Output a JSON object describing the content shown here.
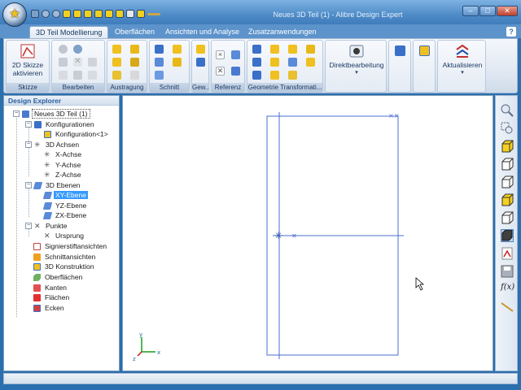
{
  "window": {
    "title": "Neues 3D Teil (1) - Alibre Design Expert",
    "minimize": "–",
    "maximize": "□",
    "close": "✕"
  },
  "ribbon": {
    "tabs": [
      {
        "label": "3D Teil Modellierung",
        "active": true
      },
      {
        "label": "Oberflächen",
        "active": false
      },
      {
        "label": "Ansichten und Analyse",
        "active": false
      },
      {
        "label": "Zusatzanwendungen",
        "active": false
      }
    ],
    "help": "?",
    "skizze_button": "2D Skizze\naktivieren",
    "direkt_button": "Direktbearbeitung",
    "aktualisieren_button": "Aktualisieren",
    "groups": {
      "skizze": "Skizze",
      "bearbeiten": "Bearbeiten",
      "austragung": "Austragung",
      "schnitt": "Schnitt",
      "gew": "Gew...",
      "referenz": "Referenz",
      "geometrie": "Geometrie Transformati..."
    }
  },
  "explorer": {
    "title": "Design Explorer",
    "nodes": {
      "root": "Neues 3D Teil (1)",
      "konfigurationen": "Konfigurationen",
      "konfiguration1": "Konfiguration<1>",
      "achsen": "3D Achsen",
      "xachse": "X-Achse",
      "yachse": "Y-Achse",
      "zachse": "Z-Achse",
      "ebenen": "3D Ebenen",
      "xy": "XY-Ebene",
      "yz": "YZ-Ebene",
      "zx": "ZX-Ebene",
      "punkte": "Punkte",
      "ursprung": "Ursprung",
      "signier": "Signierstiftansichten",
      "schnitt": "Schnittansichten",
      "konstruktion": "3D Konstruktion",
      "oberflaechen": "Oberflächen",
      "kanten": "Kanten",
      "flaechen": "Flächen",
      "ecken": "Ecken"
    }
  },
  "viewport": {
    "triad": {
      "x": "x",
      "y": "y",
      "z": "z"
    }
  },
  "view_toolbar": {
    "fx_label": "f(x)"
  },
  "colors": {
    "accent": "#2a6fae",
    "plane_line": "#4a6fd0",
    "selection": "#3399ff"
  }
}
